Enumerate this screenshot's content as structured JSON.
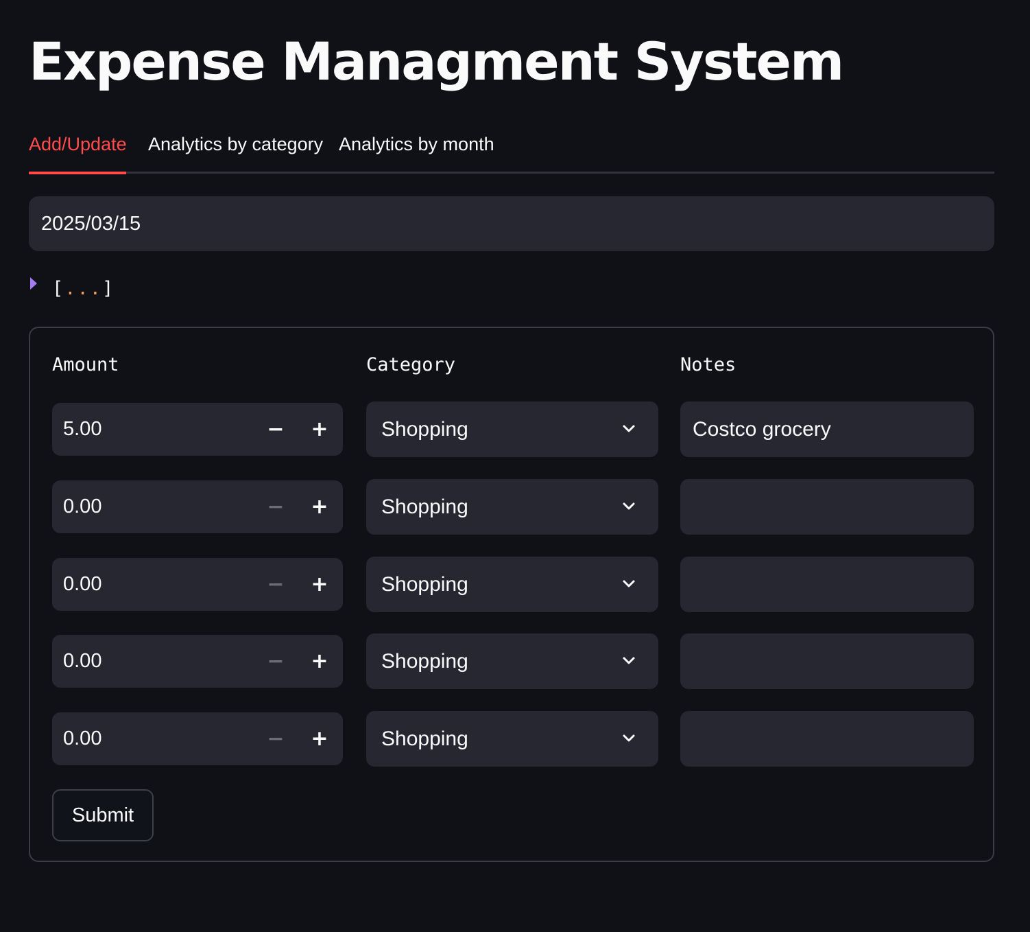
{
  "page": {
    "title": "Expense Managment System"
  },
  "tabs": [
    {
      "label": "Add/Update",
      "active": true
    },
    {
      "label": "Analytics by category",
      "active": false
    },
    {
      "label": "Analytics by month",
      "active": false
    }
  ],
  "date_input": {
    "value": "2025/03/15"
  },
  "json_viewer": {
    "open_bracket": "[",
    "dots": "...",
    "close_bracket": "]"
  },
  "form": {
    "amount_label": "Amount",
    "category_label": "Category",
    "notes_label": "Notes",
    "rows": [
      {
        "amount": "5.00",
        "category": "Shopping",
        "notes": "Costco grocery",
        "minus_enabled": true
      },
      {
        "amount": "0.00",
        "category": "Shopping",
        "notes": "",
        "minus_enabled": false
      },
      {
        "amount": "0.00",
        "category": "Shopping",
        "notes": "",
        "minus_enabled": false
      },
      {
        "amount": "0.00",
        "category": "Shopping",
        "notes": "",
        "minus_enabled": false
      },
      {
        "amount": "0.00",
        "category": "Shopping",
        "notes": "",
        "minus_enabled": false
      }
    ],
    "stepper_minus": "−",
    "stepper_plus": "+",
    "submit_label": "Submit"
  },
  "colors": {
    "background": "#0f1117",
    "input_background": "#262730",
    "accent": "#ff4b4b",
    "caret": "#a57cf5",
    "json_dots": "#f0a05a",
    "disabled_step": "#6b6d76"
  },
  "icons": {
    "select_chevron": "chevron-down-icon",
    "json_caret": "caret-right-icon"
  }
}
